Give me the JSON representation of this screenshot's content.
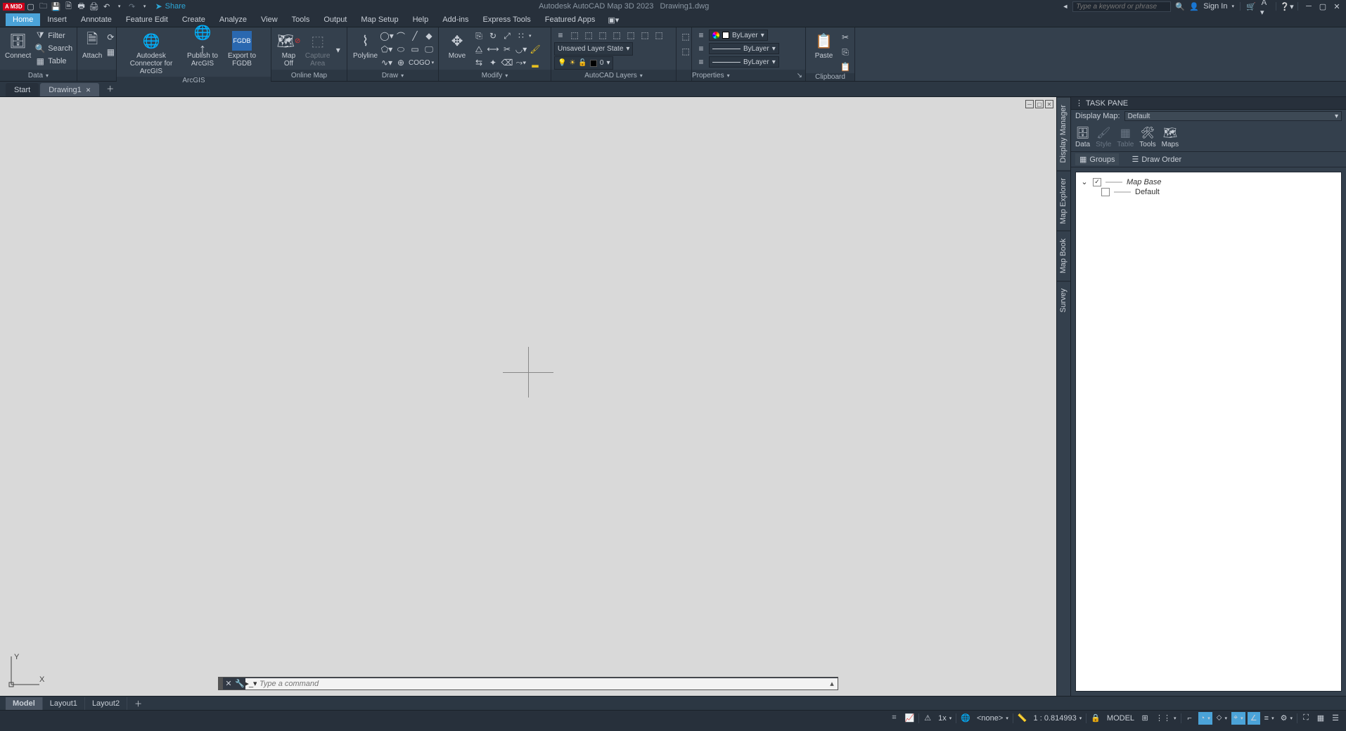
{
  "titlebar": {
    "logo": "A M3D",
    "share": "Share",
    "app_title": "Autodesk AutoCAD Map 3D 2023",
    "doc_title": "Drawing1.dwg",
    "search_placeholder": "Type a keyword or phrase",
    "signin": "Sign In"
  },
  "menubar": [
    "Home",
    "Insert",
    "Annotate",
    "Feature Edit",
    "Create",
    "Analyze",
    "View",
    "Tools",
    "Output",
    "Map Setup",
    "Help",
    "Add-ins",
    "Express Tools",
    "Featured Apps"
  ],
  "ribbon": {
    "panel_data": {
      "connect": "Connect",
      "filter": "Filter",
      "search": "Search",
      "table": "Table",
      "title": "Data"
    },
    "panel_attach": "Attach",
    "panel_arcgis": {
      "connector": "Autodesk Connector for ArcGIS",
      "publish": "Publish to ArcGIS",
      "export": "Export to FGDB",
      "title": "ArcGIS"
    },
    "panel_onlinemap": {
      "mapoff": "Map Off",
      "capture": "Capture Area",
      "title": "Online Map"
    },
    "panel_draw": {
      "polyline": "Polyline",
      "cogo": "COGO",
      "title": "Draw"
    },
    "panel_modify": {
      "move": "Move",
      "title": "Modify"
    },
    "panel_layers": {
      "state": "Unsaved Layer State",
      "layer0": "0",
      "title": "AutoCAD Layers"
    },
    "panel_props": {
      "bylayer": "ByLayer",
      "title": "Properties"
    },
    "panel_clip": {
      "paste": "Paste",
      "title": "Clipboard"
    }
  },
  "filetabs": {
    "start": "Start",
    "drawing": "Drawing1"
  },
  "taskpane": {
    "title": "TASK PANE",
    "display_map_label": "Display Map:",
    "display_map_value": "Default",
    "tabs": [
      "Data",
      "Style",
      "Table",
      "Tools",
      "Maps"
    ],
    "subtabs": {
      "groups": "Groups",
      "draworder": "Draw Order"
    },
    "tree": {
      "mapbase": "Map Base",
      "default": "Default"
    }
  },
  "sidetabs": [
    "Display Manager",
    "Map Explorer",
    "Map Book",
    "Survey"
  ],
  "cmdline": {
    "placeholder": "Type a command"
  },
  "layouttabs": [
    "Model",
    "Layout1",
    "Layout2"
  ],
  "statusbar": {
    "zoom": "1x",
    "none": "<none>",
    "scale": "1 : 0.814993",
    "model": "MODEL"
  }
}
